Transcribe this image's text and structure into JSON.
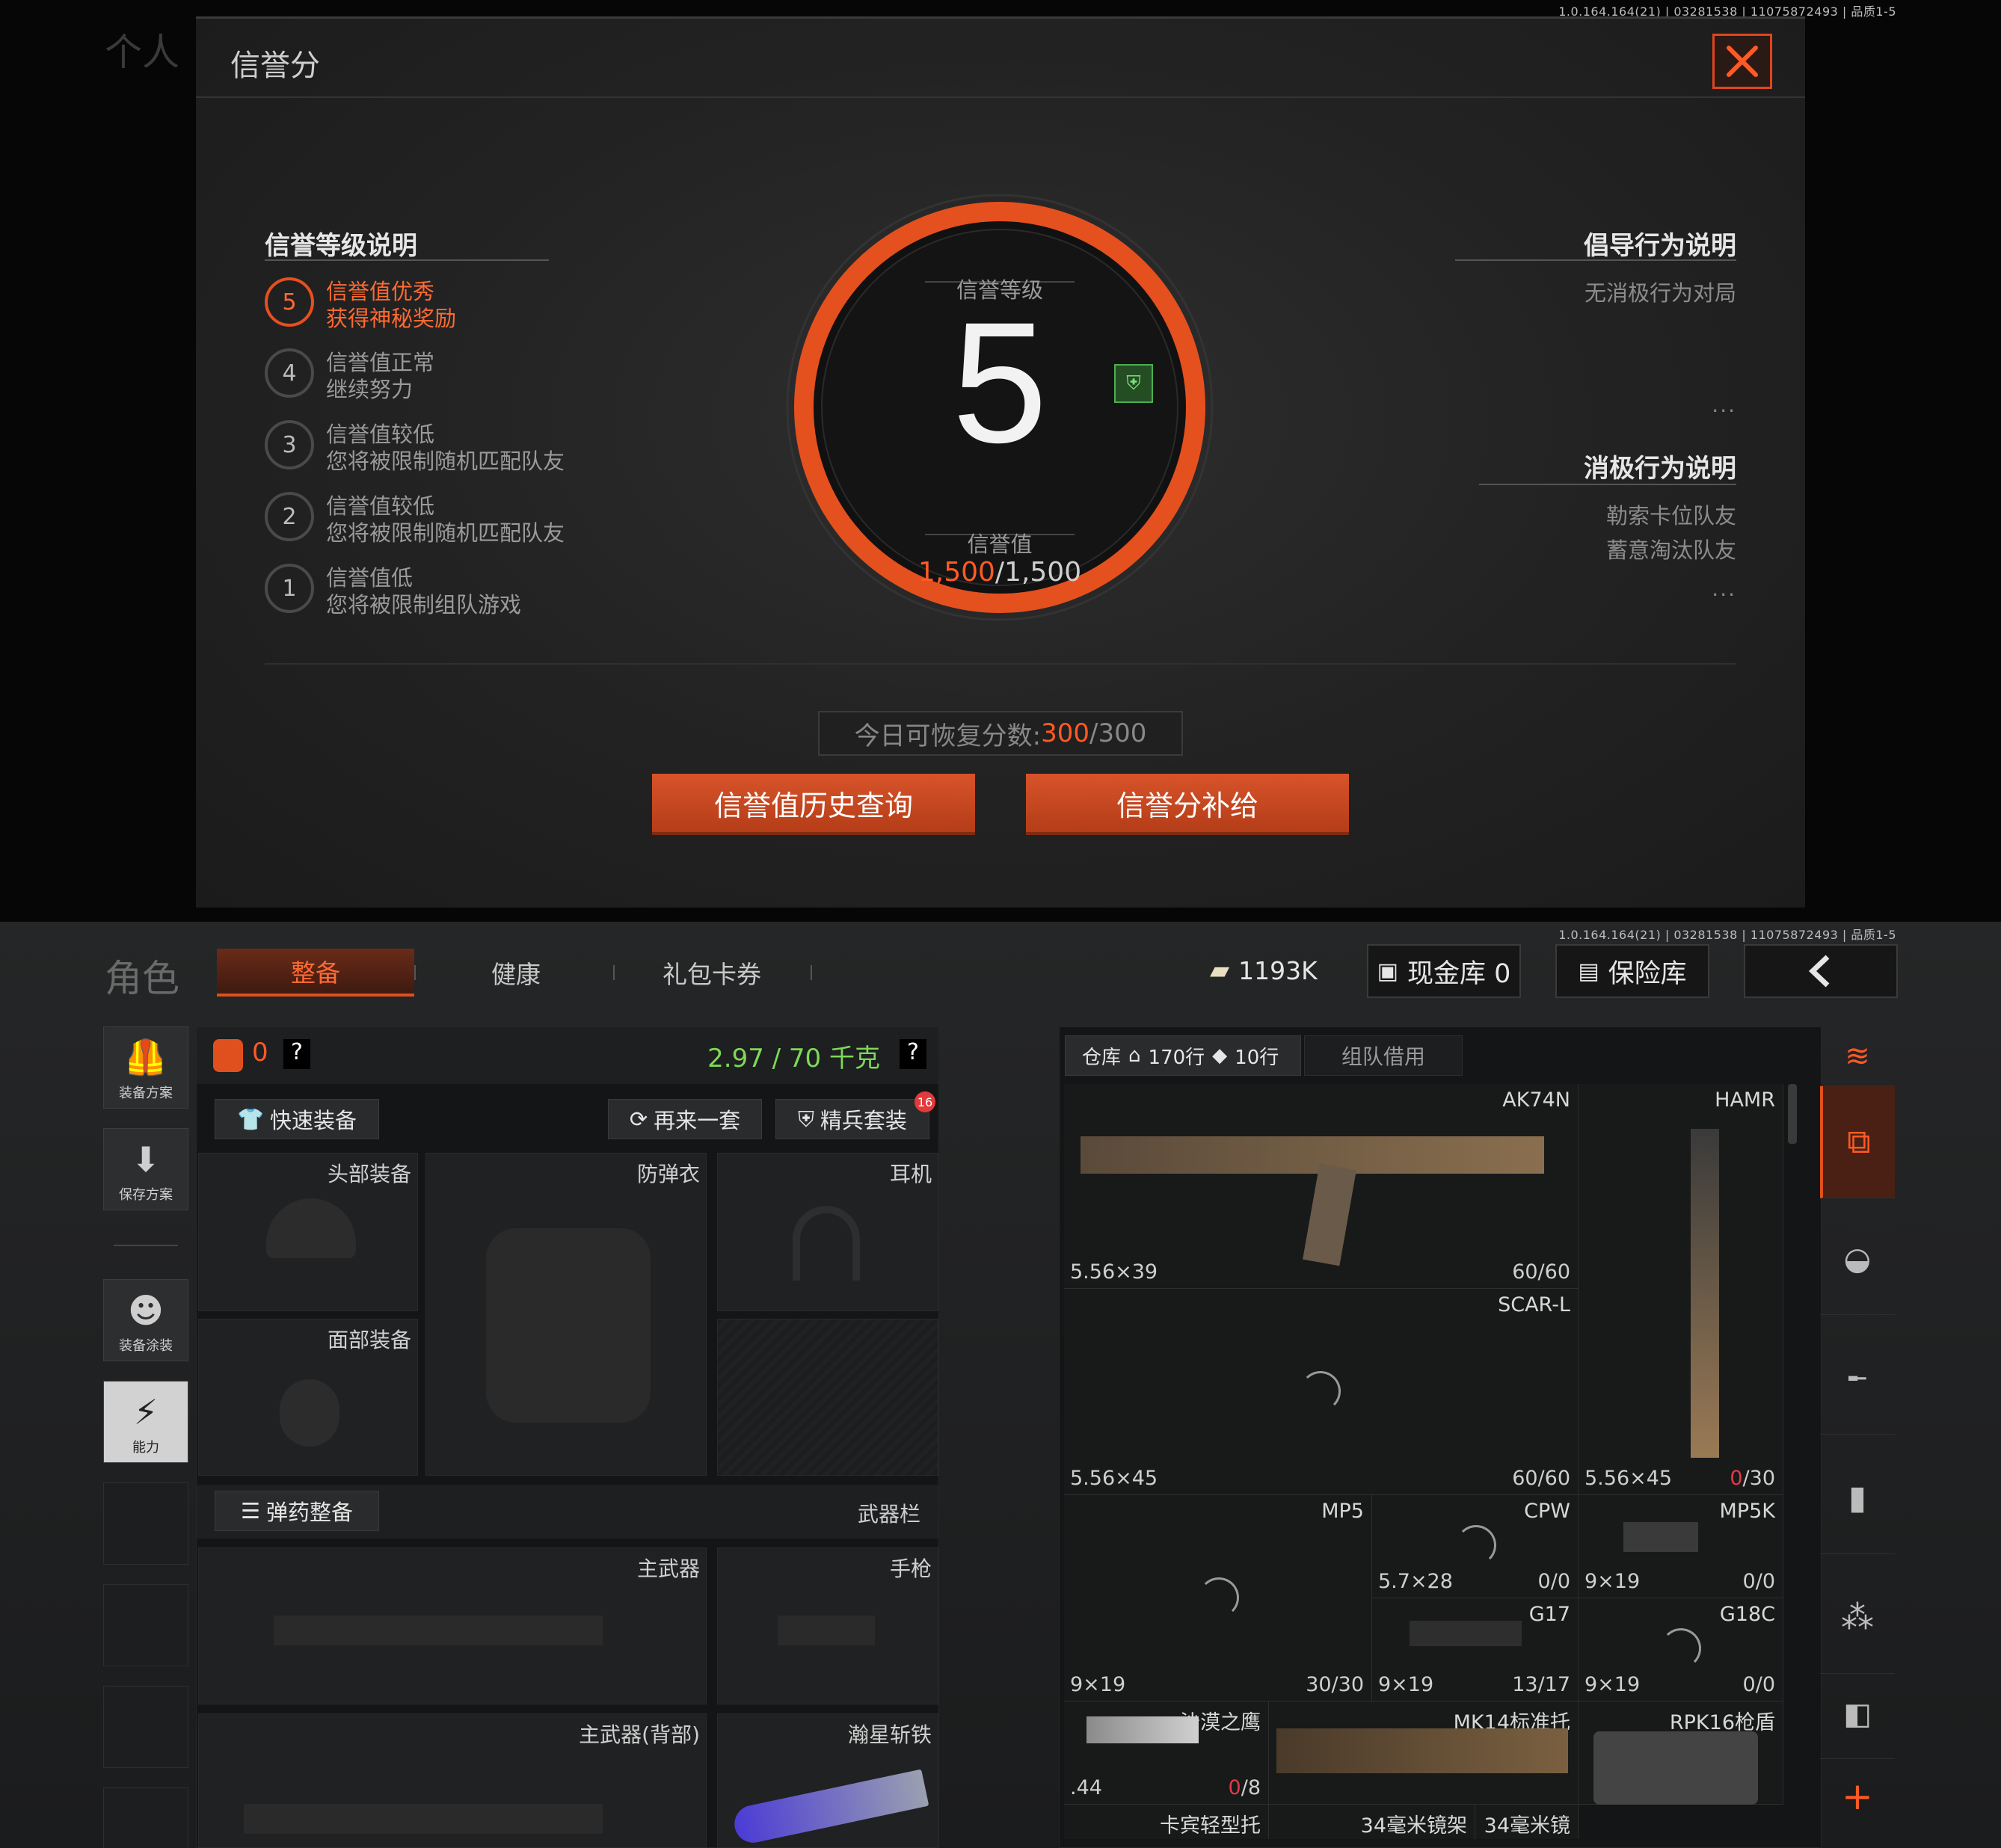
{
  "version_text": "1.0.164.164(21) | 03281538 | 11075872493 | 品质1-5",
  "modal": {
    "title": "信誉分",
    "close_icon": "close-icon",
    "levels_heading": "信誉等级说明",
    "levels": [
      {
        "num": "5",
        "line1": "信誉值优秀",
        "line2": "获得神秘奖励",
        "active": true
      },
      {
        "num": "4",
        "line1": "信誉值正常",
        "line2": "继续努力",
        "active": false
      },
      {
        "num": "3",
        "line1": "信誉值较低",
        "line2": "您将被限制随机匹配队友",
        "active": false
      },
      {
        "num": "2",
        "line1": "信誉值较低",
        "line2": "您将被限制随机匹配队友",
        "active": false
      },
      {
        "num": "1",
        "line1": "信誉值低",
        "line2": "您将被限制组队游戏",
        "active": false
      }
    ],
    "center": {
      "level_label": "信誉等级",
      "level_value": "5",
      "score_label": "信誉值",
      "score_current": "1,500",
      "score_max": "/1,500",
      "accent": "#e5501f"
    },
    "positive_heading": "倡导行为说明",
    "positive_items": [
      "无消极行为对局"
    ],
    "negative_heading": "消极行为说明",
    "negative_items": [
      "勒索卡位队友",
      "蓄意淘汰队友"
    ],
    "more": "...",
    "recover_prefix": "今日可恢复分数:",
    "recover_current": "300",
    "recover_max": "/300",
    "history_button": "信誉值历史查询",
    "supply_button": "信誉分补给"
  },
  "inventory": {
    "role": "角色",
    "tabs": [
      "整备",
      "健康",
      "礼包卡券"
    ],
    "money": "1193K",
    "cash_vault": "现金库 0",
    "safe_box": "保险库",
    "side": [
      "装备方案",
      "保存方案",
      "装备涂装",
      "能力"
    ],
    "armor_count": "0",
    "weight": "2.97 / 70 千克",
    "help": "?",
    "quick_equip": "快速装备",
    "again": "再来一套",
    "elite": "精兵套装",
    "elite_badge": "16",
    "slots": {
      "head": "头部装备",
      "vest": "防弹衣",
      "ear": "耳机",
      "face": "面部装备"
    },
    "ammo_prep": "弹药整备",
    "weapon_bar": "武器栏",
    "weapon_slots": {
      "main": "主武器",
      "pistol": "手枪",
      "main_back": "主武器(背部)",
      "melee": "瀚星斩铁"
    },
    "warehouse": {
      "tab": "仓库",
      "rows": "170行",
      "rows2": "10行",
      "team": "组队借用"
    },
    "items": [
      {
        "name": "AK74N",
        "cal": "5.56×39",
        "ammo": "60/60"
      },
      {
        "name": "HAMR",
        "cal": "5.56×45",
        "ammo_red": "0",
        "ammo_rest": "/30"
      },
      {
        "name": "SCAR-L",
        "cal": "5.56×45",
        "ammo": "60/60"
      },
      {
        "name": "MP5",
        "cal": "9×19",
        "ammo": "30/30"
      },
      {
        "name": "CPW",
        "cal": "5.7×28",
        "ammo_red": "0/0"
      },
      {
        "name": "MP5K",
        "cal": "9×19",
        "ammo_red": "0/0"
      },
      {
        "name": "G17",
        "cal": "9×19",
        "ammo": "13/17"
      },
      {
        "name": "G18C",
        "cal": "9×19",
        "ammo_red": "0/0"
      },
      {
        "name": "沙漠之鹰",
        "cal": ".44",
        "ammo_red": "0",
        "ammo_rest": "/8"
      },
      {
        "name": "MK14标准托",
        "cal": "",
        "ammo": ""
      },
      {
        "name": "RPK16枪盾",
        "cal": "",
        "ammo": ""
      }
    ],
    "bottom_labels": [
      "卡宾轻型托",
      "34毫米镜架",
      "34毫米镜"
    ]
  }
}
